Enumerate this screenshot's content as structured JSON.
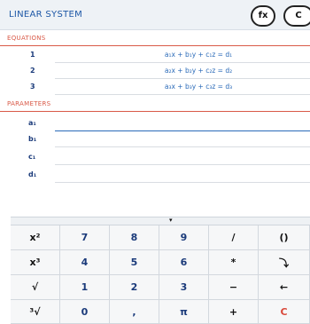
{
  "header": {
    "title": "LINEAR SYSTEM",
    "fx_label": "fx",
    "c_label": "C"
  },
  "sections": {
    "equations": "EQUATIONS",
    "parameters": "PARAMETERS"
  },
  "equations": [
    {
      "num": "1",
      "text": "a₁x + b₁y + c₁z = d₁"
    },
    {
      "num": "2",
      "text": "a₂x + b₂y + c₂z = d₂"
    },
    {
      "num": "3",
      "text": "a₃x + b₃y + c₃z = d₃"
    }
  ],
  "parameters": [
    {
      "name": "a₁",
      "value": ""
    },
    {
      "name": "b₁",
      "value": ""
    },
    {
      "name": "c₁",
      "value": ""
    },
    {
      "name": "d₁",
      "value": ""
    }
  ],
  "keypad": {
    "handle": "▾",
    "rows": [
      [
        "x²",
        "7",
        "8",
        "9",
        "/",
        "()"
      ],
      [
        "x³",
        "4",
        "5",
        "6",
        "*",
        "⤵"
      ],
      [
        "√",
        "1",
        "2",
        "3",
        "−",
        "←"
      ],
      [
        "³√",
        "0",
        ",",
        "π",
        "+",
        "C"
      ]
    ]
  }
}
